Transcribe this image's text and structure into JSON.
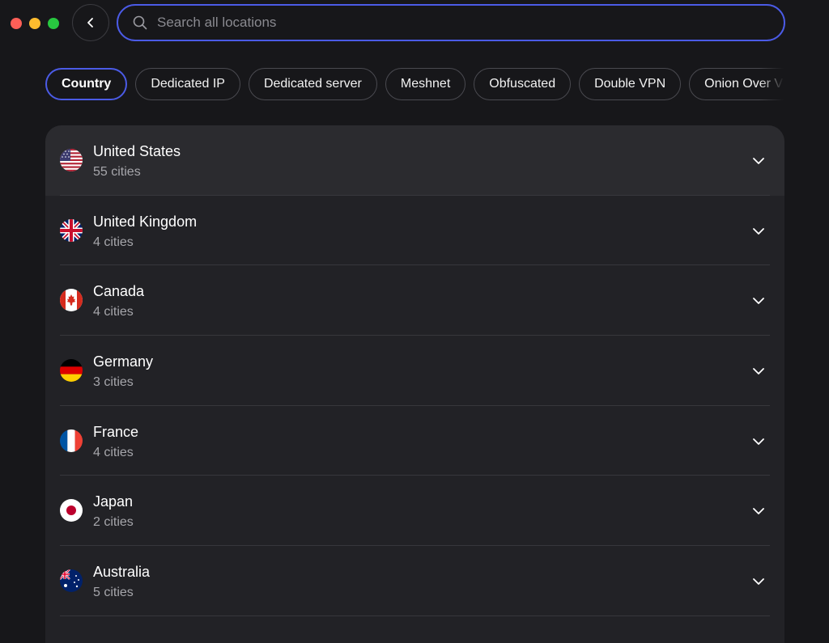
{
  "search": {
    "placeholder": "Search all locations"
  },
  "filters": [
    {
      "label": "Country",
      "active": true
    },
    {
      "label": "Dedicated IP"
    },
    {
      "label": "Dedicated server"
    },
    {
      "label": "Meshnet"
    },
    {
      "label": "Obfuscated"
    },
    {
      "label": "Double VPN"
    },
    {
      "label": "Onion Over VPN"
    }
  ],
  "countries": [
    {
      "name": "United States",
      "cities": "55 cities",
      "flag": "us-flag-icon"
    },
    {
      "name": "United Kingdom",
      "cities": "4 cities",
      "flag": "uk-flag-icon"
    },
    {
      "name": "Canada",
      "cities": "4 cities",
      "flag": "canada-flag-icon"
    },
    {
      "name": "Germany",
      "cities": "3 cities",
      "flag": "germany-flag-icon"
    },
    {
      "name": "France",
      "cities": "4 cities",
      "flag": "france-flag-icon"
    },
    {
      "name": "Japan",
      "cities": "2 cities",
      "flag": "japan-flag-icon"
    },
    {
      "name": "Australia",
      "cities": "5 cities",
      "flag": "australia-flag-icon"
    }
  ],
  "colors": {
    "accent": "#4b5be6",
    "background": "#17171a",
    "panel": "#222226"
  }
}
